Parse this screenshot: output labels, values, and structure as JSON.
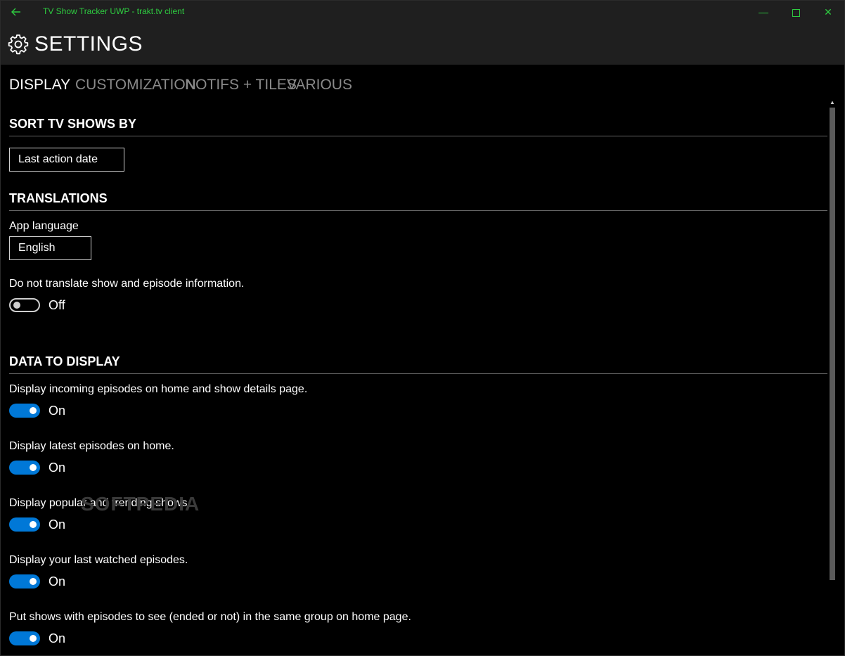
{
  "window": {
    "title": "TV Show Tracker UWP - trakt.tv client",
    "accent_color": "#2ecc40",
    "controls": {
      "minimize": "—",
      "close": "✕"
    }
  },
  "header": {
    "title": "SETTINGS",
    "icon": "gear-icon"
  },
  "tabs": [
    {
      "label": "DISPLAY",
      "active": true
    },
    {
      "label": "CUSTOMIZATION",
      "active": false
    },
    {
      "label": "NOTIFS + TILES",
      "active": false
    },
    {
      "label": "VARIOUS",
      "active": false
    }
  ],
  "sections": {
    "sort": {
      "heading": "SORT TV SHOWS BY",
      "selected": "Last action date"
    },
    "translations": {
      "heading": "TRANSLATIONS",
      "language_label": "App language",
      "language_selected": "English",
      "no_translate_label": "Do not translate show and episode information.",
      "no_translate_state": "Off"
    },
    "data_display": {
      "heading": "DATA TO DISPLAY",
      "items": [
        {
          "label": "Display incoming episodes on home and show details page.",
          "state": "On"
        },
        {
          "label": "Display latest episodes on home.",
          "state": "On"
        },
        {
          "label": "Display popular and trending shows.",
          "state": "On"
        },
        {
          "label": "Display your last watched episodes.",
          "state": "On"
        },
        {
          "label": "Put shows with episodes to see (ended or not) in the same group on home page.",
          "state": "On"
        }
      ]
    }
  },
  "toggle_on_color": "#0078d7",
  "watermark": "SOFTPEDIA"
}
